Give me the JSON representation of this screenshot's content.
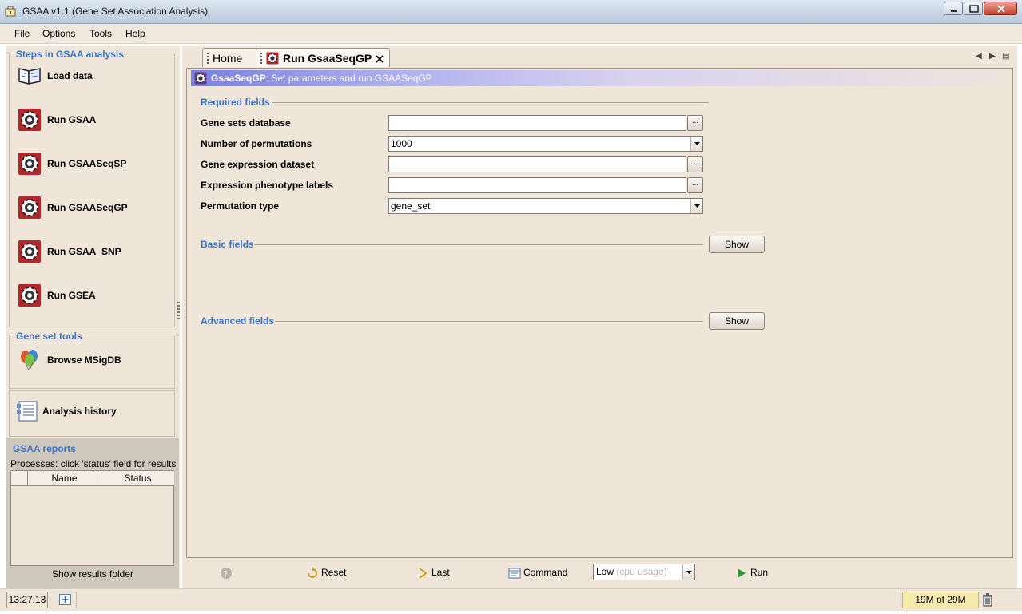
{
  "window": {
    "title": "GSAA v1.1 (Gene Set Association Analysis)"
  },
  "menu": [
    "File",
    "Options",
    "Tools",
    "Help"
  ],
  "steps": {
    "title": "Steps in GSAA analysis",
    "items": [
      "Load data",
      "Run GSAA",
      "Run GSAASeqSP",
      "Run GSAASeqGP",
      "Run GSAA_SNP",
      "Run GSEA"
    ]
  },
  "gene_set_tools": {
    "title": "Gene set tools",
    "browse": "Browse MSigDB"
  },
  "history": {
    "label": "Analysis history"
  },
  "reports": {
    "title": "GSAA reports",
    "hint": "Processes: click 'status' field for results",
    "columns": [
      "",
      "Name",
      "Status"
    ],
    "folder": "Show results folder"
  },
  "tabs": {
    "home": "Home",
    "active": "Run GsaaSeqGP"
  },
  "banner": {
    "name": "GsaaSeqGP",
    "text": ": Set parameters and run GSAASeqGP"
  },
  "required": {
    "title": "Required fields",
    "gene_sets_label": "Gene sets database",
    "gene_sets_value": "",
    "permutations_label": "Number of permutations",
    "permutations_value": "1000",
    "expression_label": "Gene expression dataset",
    "expression_value": "",
    "phenotype_label": "Expression phenotype labels",
    "phenotype_value": "",
    "perm_type_label": "Permutation type",
    "perm_type_value": "gene_set",
    "browse_label": "..."
  },
  "basic": {
    "title": "Basic fields",
    "button": "Show"
  },
  "advanced": {
    "title": "Advanced fields",
    "button": "Show"
  },
  "toolbar": {
    "reset": "Reset",
    "last": "Last",
    "command": "Command",
    "cpu_value": "Low",
    "cpu_hint": "(cpu usage)",
    "run": "Run"
  },
  "status": {
    "time": "13:27:13",
    "memory": "19M of 29M"
  },
  "colors": {
    "accent_blue": "#3b72c5",
    "panel_bg": "#efe6d9"
  }
}
